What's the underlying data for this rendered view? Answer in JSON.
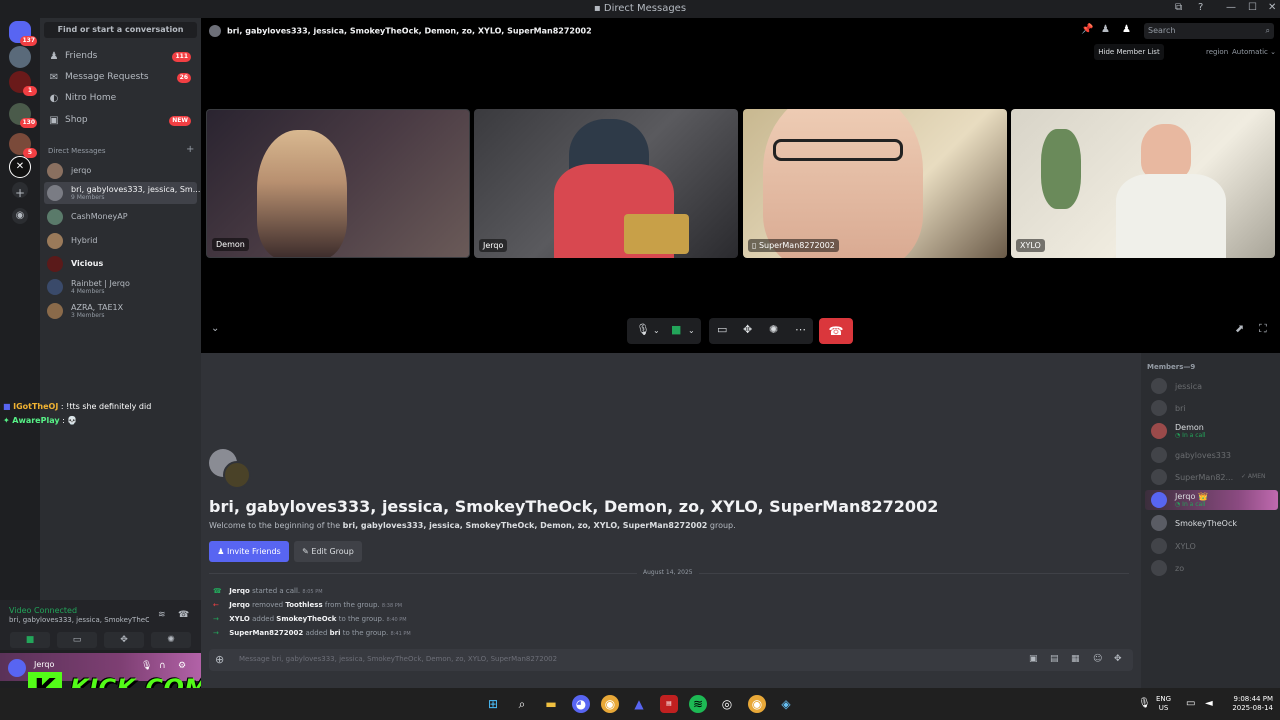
{
  "window": {
    "title": "Direct Messages"
  },
  "rail": {
    "badges": [
      "137",
      "1",
      "130",
      "5"
    ]
  },
  "sidebar": {
    "find_label": "Find or start a conversation",
    "nav": [
      {
        "label": "Friends",
        "badge": "111"
      },
      {
        "label": "Message Requests",
        "badge": "26"
      },
      {
        "label": "Nitro Home",
        "badge": ""
      },
      {
        "label": "Shop",
        "badge": "NEW"
      }
    ],
    "dm_header": "Direct Messages",
    "dms": [
      {
        "name": "jerqo",
        "sub": ""
      },
      {
        "name": "bri, gabyloves333, jessica, Sm...",
        "sub": "9 Members"
      },
      {
        "name": "CashMoneyAP",
        "sub": ""
      },
      {
        "name": "Hybrid",
        "sub": ""
      },
      {
        "name": "Vicious",
        "sub": ""
      },
      {
        "name": "Rainbet | Jerqo",
        "sub": "4 Members"
      },
      {
        "name": "AZRA, TAE1X",
        "sub": "3 Members"
      }
    ]
  },
  "overlay_chat": [
    {
      "user": "IGotTheOJ",
      "sep": ":",
      "text": "!tts she definitely did"
    },
    {
      "user": "AwarePlay",
      "sep": ":",
      "text": "💀"
    }
  ],
  "voice": {
    "status": "Video Connected",
    "channel": "bri, gabyloves333, jessica, SmokeyTheOck"
  },
  "user": {
    "name": "Jerqo"
  },
  "kick": {
    "logo": "K",
    "text": "KICK.COM/JERQO"
  },
  "call": {
    "header": "bri, gabyloves333, jessica, SmokeyTheOck, Demon, zo, XYLO, SuperMan8272002",
    "search_placeholder": "Search",
    "tooltip": "Hide Member List",
    "region_label": "region",
    "region_value": "Automatic",
    "tiles": [
      {
        "name": "Demon"
      },
      {
        "name": "Jerqo"
      },
      {
        "name": "SuperMan8272002"
      },
      {
        "name": "XYLO"
      }
    ]
  },
  "chat": {
    "title": "bri, gabyloves333, jessica, SmokeyTheOck, Demon, zo, XYLO, SuperMan8272002",
    "welcome_prefix": "Welcome to the beginning of the",
    "welcome_group": "bri, gabyloves333, jessica, SmokeyTheOck, Demon, zo, XYLO, SuperMan8272002",
    "welcome_suffix": "group.",
    "invite_label": "Invite Friends",
    "edit_label": "Edit Group",
    "date": "August 14, 2025",
    "events": [
      {
        "actor": "Jerqo",
        "action": "started a call.",
        "target": "",
        "rest": "",
        "time": "8:05 PM"
      },
      {
        "actor": "Jerqo",
        "action": "removed",
        "target": "Toothless",
        "rest": "from the group.",
        "time": "8:38 PM"
      },
      {
        "actor": "XYLO",
        "action": "added",
        "target": "SmokeyTheOck",
        "rest": "to the group.",
        "time": "8:40 PM"
      },
      {
        "actor": "SuperMan8272002",
        "action": "added",
        "target": "bri",
        "rest": "to the group.",
        "time": "8:41 PM"
      }
    ],
    "input_placeholder": "Message bri, gabyloves333, jessica, SmokeyTheOck, Demon, zo, XYLO, SuperMan8272002"
  },
  "members": {
    "header": "Members—9",
    "list": [
      {
        "name": "jessica",
        "status": "",
        "tag": ""
      },
      {
        "name": "bri",
        "status": "",
        "tag": ""
      },
      {
        "name": "Demon",
        "status": "In a call",
        "tag": ""
      },
      {
        "name": "gabyloves333",
        "status": "",
        "tag": ""
      },
      {
        "name": "SuperMan82...",
        "status": "",
        "tag": "✓ AMEN"
      },
      {
        "name": "Jerqo 👑",
        "status": "In a call",
        "tag": ""
      },
      {
        "name": "SmokeyTheOck",
        "status": "",
        "tag": ""
      },
      {
        "name": "XYLO",
        "status": "",
        "tag": ""
      },
      {
        "name": "zo",
        "status": "",
        "tag": ""
      }
    ]
  },
  "taskbar": {
    "lang": "ENG",
    "region": "US",
    "time": "9:08:44 PM",
    "date": "2025-08-14"
  },
  "colors": {
    "accent": "#5865f2",
    "danger": "#da373c",
    "online": "#23a55a",
    "kick": "#53fc18"
  }
}
